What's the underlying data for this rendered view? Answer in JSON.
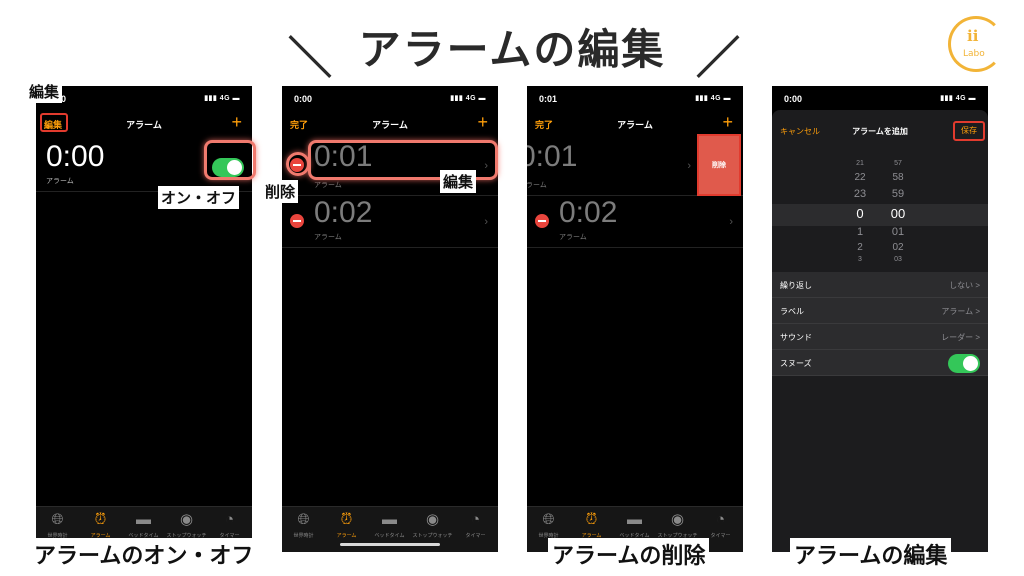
{
  "title": "アラームの編集",
  "title_slash_left": "＼",
  "title_slash_right": "／",
  "logo": {
    "mark": "ii",
    "text": "Labo"
  },
  "colors": {
    "accent": "#ff9f0a",
    "toggle_on": "#34c759",
    "delete": "#e9453d",
    "highlight": "#e23b2e"
  },
  "annotations": {
    "edit": "編集",
    "onoff": "オン・オフ",
    "delete": "削除",
    "edit_row": "編集"
  },
  "captions": [
    "アラームのオン・オフ",
    "アラームの削除",
    "アラームの編集"
  ],
  "tabs": [
    {
      "label": "世界時計",
      "icon": "globe-icon"
    },
    {
      "label": "アラーム",
      "icon": "alarm-clock-icon"
    },
    {
      "label": "ベッドタイム",
      "icon": "bed-icon"
    },
    {
      "label": "ストップウォッチ",
      "icon": "stopwatch-icon"
    },
    {
      "label": "タイマー",
      "icon": "timer-icon"
    }
  ],
  "screen1": {
    "status_time": "0:00",
    "signal": "4G",
    "nav_left": "編集",
    "nav_title": "アラーム",
    "nav_plus": "+",
    "alarm": {
      "time": "0:00",
      "label": "アラーム",
      "enabled": true
    }
  },
  "screen2": {
    "status_time": "0:00",
    "signal": "4G",
    "nav_left": "完了",
    "nav_title": "アラーム",
    "nav_plus": "+",
    "alarms": [
      {
        "time": "0:01",
        "label": "アラーム"
      },
      {
        "time": "0:02",
        "label": "アラーム"
      }
    ]
  },
  "screen3": {
    "status_time": "0:01",
    "signal": "4G",
    "nav_left": "完了",
    "nav_title": "アラーム",
    "nav_plus": "+",
    "alarms": [
      {
        "time": "0:01",
        "label": "アラーム"
      },
      {
        "time": "0:02",
        "label": "アラーム"
      }
    ],
    "delete_label": "削除"
  },
  "screen4": {
    "status_time": "0:00",
    "signal": "4G",
    "cancel": "キャンセル",
    "title": "アラームを追加",
    "save": "保存",
    "picker": {
      "hours": [
        "21",
        "22",
        "23",
        "0",
        "1",
        "2",
        "3"
      ],
      "minutes": [
        "57",
        "58",
        "59",
        "00",
        "01",
        "02",
        "03"
      ]
    },
    "settings": [
      {
        "key": "繰り返し",
        "value": "しない",
        "chevron": ">"
      },
      {
        "key": "ラベル",
        "value": "アラーム",
        "chevron": ">"
      },
      {
        "key": "サウンド",
        "value": "レーダー",
        "chevron": ">"
      },
      {
        "key": "スヌーズ",
        "value": "",
        "toggle": true
      }
    ]
  }
}
